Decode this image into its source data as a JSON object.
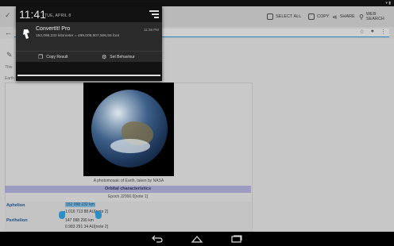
{
  "status_bar": {
    "icons": "▾ ▮"
  },
  "shade": {
    "clock": "11:41",
    "date": "TUE, APRIL 8",
    "notification": {
      "app_name": "ConvertIt! Pro",
      "time": "11:36 PM",
      "text": "152,098,232 kilometer = 499,009,907,506,56 foot",
      "actions": [
        {
          "label": "Copy Result",
          "icon": "copy-icon"
        },
        {
          "label": "Set Behaviour",
          "icon": "gear-icon"
        }
      ]
    }
  },
  "browser": {
    "toolbar": {
      "select_all": "SELECT ALL",
      "copy": "COPY",
      "share": "SHARE",
      "web_search": "WEB SEARCH"
    },
    "page": {
      "italic_text": "This",
      "intro_text": "Earth",
      "image_caption": "A photomosaic of Earth, taken by NASA",
      "section_header": "Orbital characteristics",
      "epoch": "Epoch J2000.0[note 1]",
      "rows": [
        {
          "label": "Aphelion",
          "values": [
            "152 098 232 km",
            "1.016 713 88 AU[note 2]"
          ]
        },
        {
          "label": "Perihelion",
          "values": [
            "147 098 290 km",
            "0.983 291 34 AU[note 2]"
          ]
        }
      ]
    }
  },
  "nav": {
    "back": "back",
    "home": "home",
    "recents": "recents"
  },
  "colors": {
    "accent": "#2a8fc2",
    "selection": "#6fa7c9",
    "header": "#9c9cc0"
  }
}
